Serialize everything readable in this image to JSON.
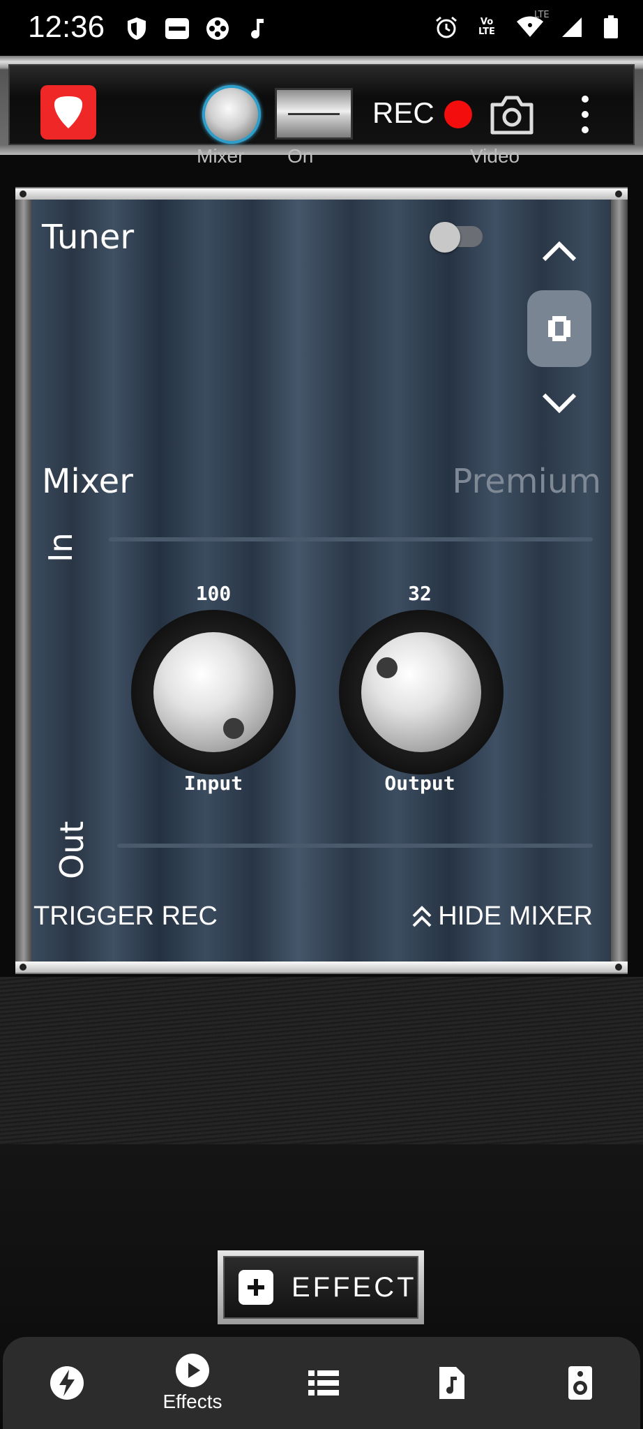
{
  "status_bar": {
    "time": "12:36",
    "left_icons": [
      "shield-icon",
      "paytm-icon",
      "game-controller-icon",
      "music-note-icon"
    ],
    "right_icons": [
      "alarm-icon",
      "volte-icon",
      "wifi-icon",
      "signal-icon",
      "battery-icon"
    ],
    "volte_label": "Vo LTE",
    "lte_label": "LTE"
  },
  "toolbar": {
    "rec_label": "REC",
    "mixer_label": "Mixer",
    "on_label": "On",
    "video_label": "Video",
    "colors": {
      "logo": "#ef2727",
      "rec_dot": "#f30d0d",
      "mixer_ring": "#2d9ec9"
    }
  },
  "panel": {
    "tuner_label": "Tuner",
    "tuner_enabled": false,
    "mixer_label": "Mixer",
    "premium_label": "Premium",
    "in_label": "In",
    "out_label": "Out",
    "knobs": [
      {
        "label": "Input",
        "value": "100"
      },
      {
        "label": "Output",
        "value": "32"
      }
    ],
    "trigger_rec_label": "TRIGGER REC",
    "hide_mixer_label": "HIDE MIXER"
  },
  "effect_button": {
    "label": "EFFECT"
  },
  "bottom_nav": {
    "items": [
      {
        "icon": "lightning-icon",
        "label": ""
      },
      {
        "icon": "play-icon",
        "label": "Effects",
        "active": true
      },
      {
        "icon": "list-icon",
        "label": ""
      },
      {
        "icon": "music-file-icon",
        "label": ""
      },
      {
        "icon": "speaker-icon",
        "label": ""
      }
    ]
  }
}
